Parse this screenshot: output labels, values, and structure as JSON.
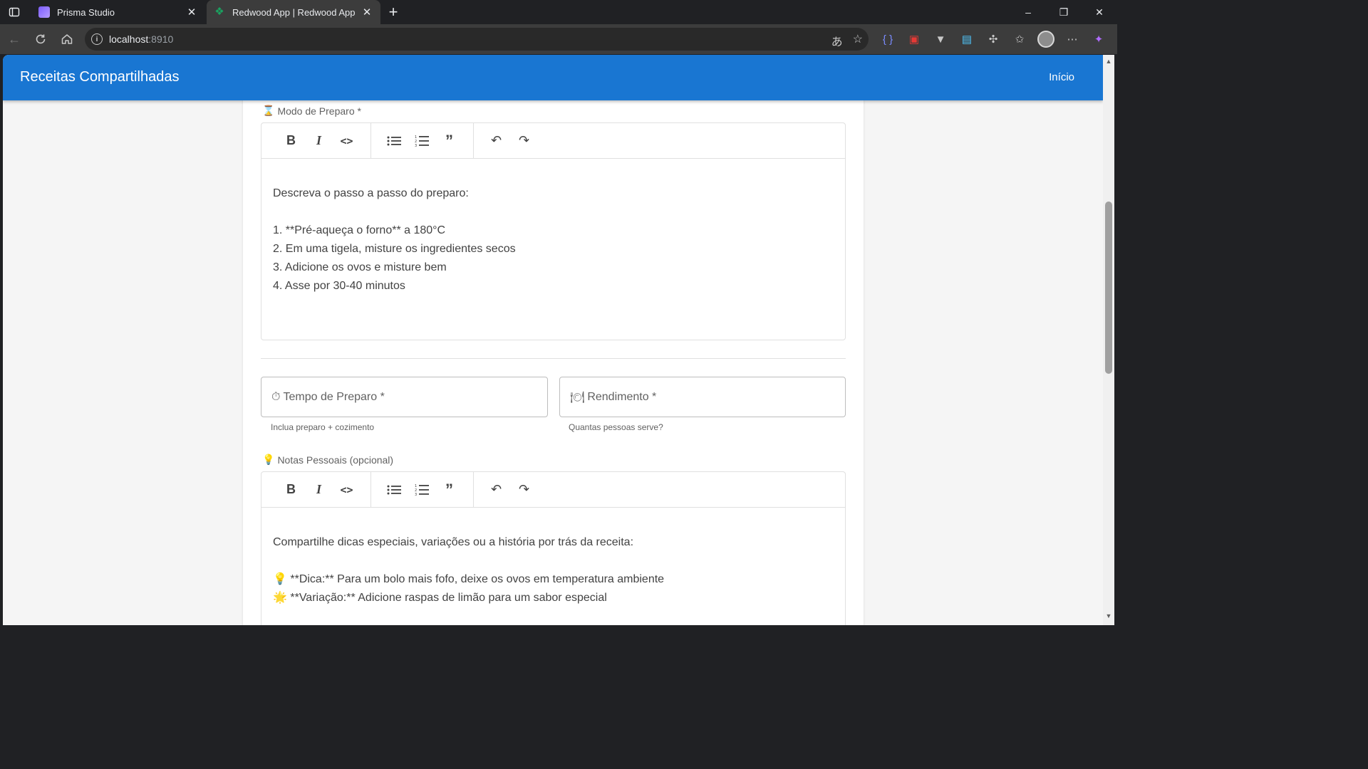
{
  "browser": {
    "tabs": [
      {
        "title": "Prisma Studio",
        "active": false
      },
      {
        "title": "Redwood App | Redwood App",
        "active": true
      }
    ],
    "new_tab": "+",
    "url_host": "localhost",
    "url_port": ":8910",
    "window_controls": {
      "minimize": "–",
      "restore": "❐",
      "close": "✕"
    }
  },
  "app": {
    "title": "Receitas Compartilhadas",
    "nav_home": "Início",
    "brand_color": "#1976d2"
  },
  "form": {
    "preparo": {
      "label": "Modo de Preparo *",
      "emoji": "⌛",
      "lines": [
        "Descreva o passo a passo do preparo:",
        "",
        "1. **Pré-aqueça o forno** a 180°C",
        "2. Em uma tigela, misture os ingredientes secos",
        "3. Adicione os ovos e misture bem",
        "4. Asse por 30-40 minutos"
      ]
    },
    "tempo": {
      "label": "Tempo de Preparo *",
      "emoji": "⏱",
      "helper": "Inclua preparo + cozimento"
    },
    "rendimento": {
      "label": "Rendimento *",
      "emoji": "🍽",
      "helper": "Quantas pessoas serve?"
    },
    "notas": {
      "label": "Notas Pessoais (opcional)",
      "emoji": "💡",
      "lines": [
        "Compartilhe dicas especiais, variações ou a história por trás da receita:",
        "",
        "💡 **Dica:** Para um bolo mais fofo, deixe os ovos em temperatura ambiente",
        "🌟 **Variação:** Adicione raspas de limão para um sabor especial"
      ]
    },
    "toolbar": {
      "bold": "B",
      "italic": "I",
      "code": "<>",
      "bullet_list": "☰",
      "ordered_list": "☷",
      "quote": "❞",
      "undo": "↶",
      "redo": "↷"
    }
  }
}
